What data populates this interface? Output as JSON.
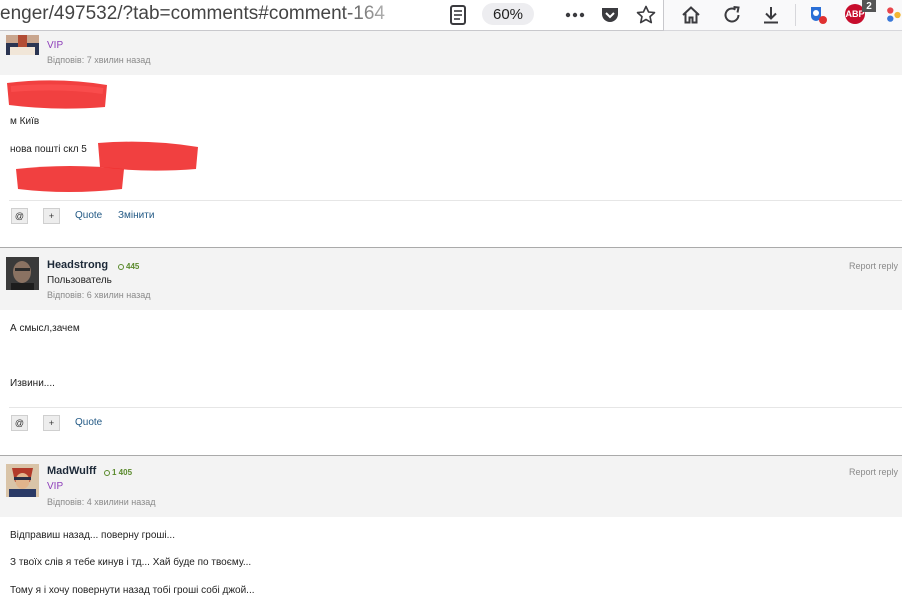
{
  "browser": {
    "url": "enger/497532/?tab=comments#comment-164",
    "zoom": "60%",
    "icons": [
      "reader-view-icon",
      "page-actions-icon",
      "pocket-icon",
      "bookmark-star-icon",
      "home-icon",
      "reload-icon",
      "download-icon",
      "extension-privacy-icon",
      "adblock-icon",
      "extension-icon"
    ],
    "adblock_label": "ABP",
    "adblock_badge": "2"
  },
  "posts": [
    {
      "group": "VIP",
      "time": "Відповів: 7 хвилин назад",
      "body": [
        "м Київ",
        "нова пошті скл 5"
      ],
      "controls": {
        "mention": "@",
        "plus": "+",
        "quote": "Quote",
        "edit": "Змінити"
      }
    },
    {
      "author": "Headstrong",
      "reputation": "445",
      "group": "Пользователь",
      "time": "Відповів: 6 хвилин назад",
      "report": "Report reply",
      "body": [
        "А смысл,зачем",
        "Извини...."
      ],
      "controls": {
        "mention": "@",
        "plus": "+",
        "quote": "Quote"
      }
    },
    {
      "author": "MadWulff",
      "reputation": "1 405",
      "group": "VIP",
      "time": "Відповів: 4 хвилини назад",
      "report": "Report reply",
      "body": [
        "Відправиш назад... поверну гроші...",
        "З твоїх слів я тебе кинув і тд...  Хай буде по твоєму...",
        "Тому я і хочу повернути назад тобі гроші собі джой..."
      ]
    }
  ],
  "colors": {
    "vip": "#8e3fba",
    "link": "#225985",
    "reputation": "#5a8a2c",
    "redaction": "#ef2b2b"
  }
}
